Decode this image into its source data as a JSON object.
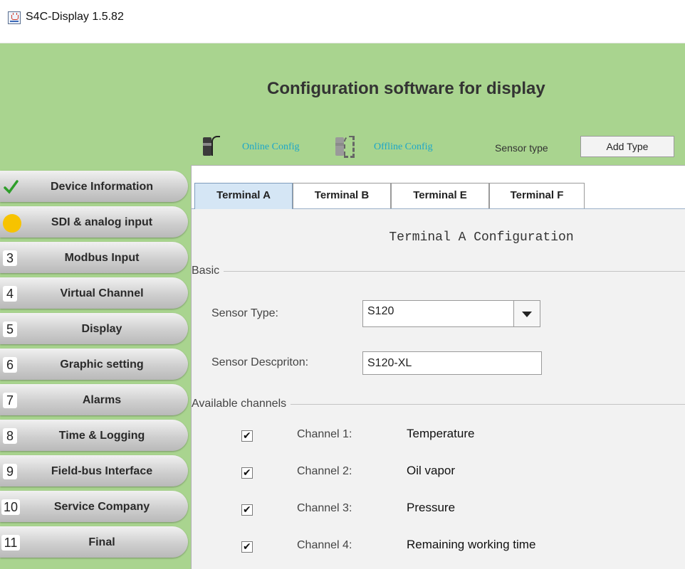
{
  "window": {
    "title": "S4C-Display 1.5.82"
  },
  "header": {
    "heading": "Configuration software for display",
    "online_config": "Online Config",
    "offline_config": "Offline Config",
    "sensor_type_label": "Sensor type",
    "add_type_button": "Add Type"
  },
  "sidebar": {
    "items": [
      {
        "num": "",
        "label": "Device Information",
        "status": "check"
      },
      {
        "num": "",
        "label": "SDI & analog input",
        "status": "current"
      },
      {
        "num": "3",
        "label": "Modbus Input"
      },
      {
        "num": "4",
        "label": "Virtual Channel"
      },
      {
        "num": "5",
        "label": "Display"
      },
      {
        "num": "6",
        "label": "Graphic setting"
      },
      {
        "num": "7",
        "label": "Alarms"
      },
      {
        "num": "8",
        "label": "Time & Logging"
      },
      {
        "num": "9",
        "label": "Field-bus Interface"
      },
      {
        "num": "10",
        "label": "Service Company"
      },
      {
        "num": "11",
        "label": "Final"
      }
    ]
  },
  "tabs": [
    "Terminal A",
    "Terminal B",
    "Terminal E",
    "Terminal F"
  ],
  "panel": {
    "title": "Terminal A Configuration",
    "basic_label": "Basic",
    "sensor_type_label": "Sensor Type:",
    "sensor_type_value": "S120",
    "sensor_desc_label": "Sensor Descpriton:",
    "sensor_desc_value": "S120-XL",
    "channels_label": "Available channels",
    "channels": [
      {
        "label": "Channel 1:",
        "name": "Temperature",
        "checked": true
      },
      {
        "label": "Channel 2:",
        "name": "Oil vapor",
        "checked": true
      },
      {
        "label": "Channel 3:",
        "name": "Pressure",
        "checked": true
      },
      {
        "label": "Channel 4:",
        "name": "Remaining working time",
        "checked": true
      }
    ]
  },
  "colors": {
    "header_green": "#a9d48f",
    "link_cyan": "#1ca6c9",
    "current_dot": "#f7c300",
    "check_green": "#2e9e2a"
  }
}
